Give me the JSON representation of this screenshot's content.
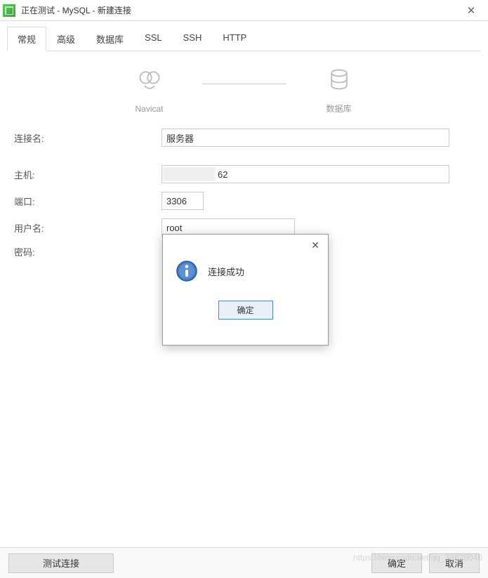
{
  "window": {
    "title": "正在测试 - MySQL - 新建连接",
    "close": "✕"
  },
  "tabs": {
    "general": "常规",
    "advanced": "高级",
    "database": "数据库",
    "ssl": "SSL",
    "ssh": "SSH",
    "http": "HTTP"
  },
  "diagram": {
    "navicat": "Navicat",
    "database": "数据库"
  },
  "form": {
    "connection_name_label": "连接名:",
    "connection_name_value": "服务器",
    "host_label": "主机:",
    "host_suffix": "62",
    "port_label": "端口:",
    "port_value": "3306",
    "user_label": "用户名:",
    "user_value": "root",
    "password_label": "密码:"
  },
  "footer": {
    "test": "测试连接",
    "ok": "确定",
    "cancel": "取消"
  },
  "modal": {
    "close": "✕",
    "message": "连接成功",
    "ok": "确定"
  },
  "watermark": "https://blog.csdn.net/qq_38628046"
}
